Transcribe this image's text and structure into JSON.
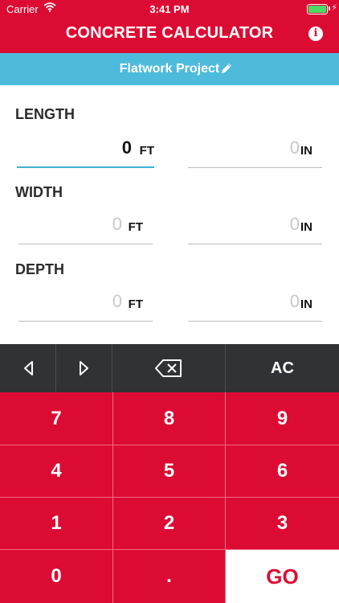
{
  "status_bar": {
    "carrier": "Carrier",
    "time": "3:41 PM"
  },
  "header": {
    "title": "CONCRETE CALCULATOR",
    "info_glyph": "i"
  },
  "project": {
    "name": "Flatwork Project"
  },
  "dimensions": {
    "length": {
      "label": "LENGTH",
      "ft_value": "0",
      "ft_unit": "FT",
      "in_value": "0",
      "in_unit": "IN"
    },
    "width": {
      "label": "WIDTH",
      "ft_value": "0",
      "ft_unit": "FT",
      "in_value": "0",
      "in_unit": "IN"
    },
    "depth": {
      "label": "DEPTH",
      "ft_value": "0",
      "ft_unit": "FT",
      "in_value": "0",
      "in_unit": "IN"
    }
  },
  "keypad": {
    "clear": "AC",
    "k7": "7",
    "k8": "8",
    "k9": "9",
    "k4": "4",
    "k5": "5",
    "k6": "6",
    "k1": "1",
    "k2": "2",
    "k3": "3",
    "k0": "0",
    "dot": ".",
    "go": "GO"
  },
  "colors": {
    "primary": "#dc0b33",
    "accent": "#4ebbdc",
    "keypad_dark": "#303236"
  }
}
